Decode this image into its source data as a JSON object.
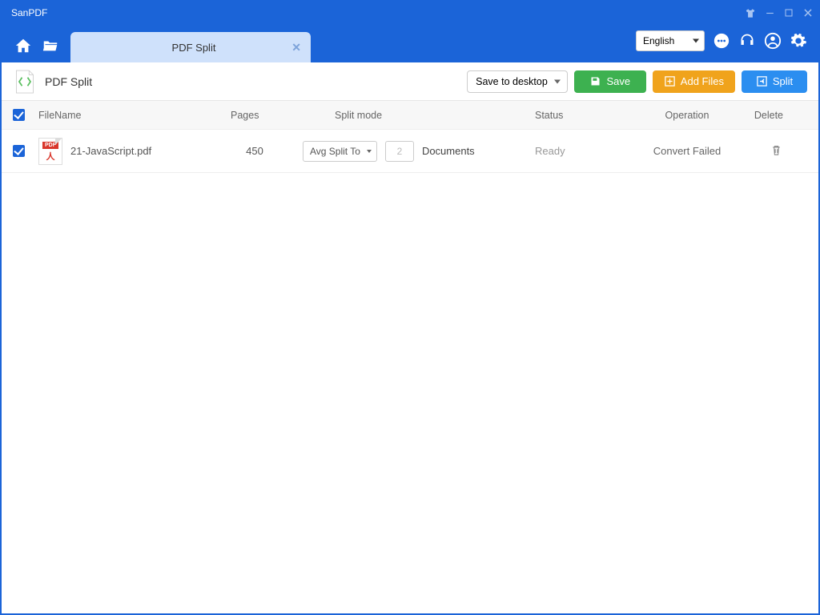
{
  "app": {
    "title": "SanPDF"
  },
  "tab": {
    "label": "PDF Split"
  },
  "menubar": {
    "language": "English"
  },
  "toolbar": {
    "title": "PDF Split",
    "save_to": "Save to desktop",
    "save_label": "Save",
    "add_label": "Add Files",
    "split_label": "Split"
  },
  "table": {
    "headers": {
      "filename": "FileName",
      "pages": "Pages",
      "mode": "Split mode",
      "status": "Status",
      "operation": "Operation",
      "delete": "Delete"
    },
    "rows": [
      {
        "filename": "21-JavaScript.pdf",
        "pages": "450",
        "mode_option": "Avg Split To",
        "mode_count": "2",
        "mode_unit": "Documents",
        "status": "Ready",
        "operation": "Convert Failed"
      }
    ]
  }
}
